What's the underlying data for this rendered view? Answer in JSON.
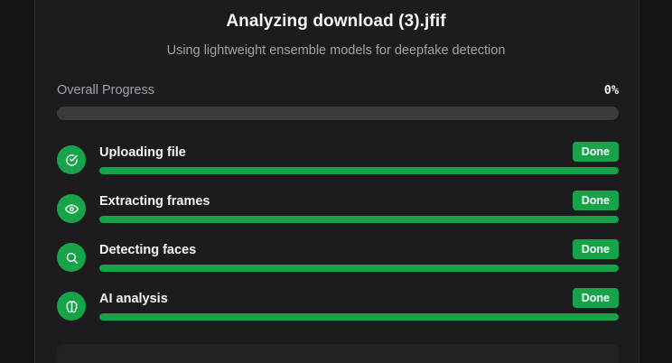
{
  "header": {
    "title": "Analyzing download (3).jfif",
    "subtitle": "Using lightweight ensemble models for deepfake detection"
  },
  "overall": {
    "label": "Overall Progress",
    "value_text": "0%",
    "progress": 0
  },
  "steps": [
    {
      "label": "Uploading file",
      "status": "Done",
      "progress": 100,
      "icon": "check-circle-icon"
    },
    {
      "label": "Extracting frames",
      "status": "Done",
      "progress": 100,
      "icon": "eye-icon"
    },
    {
      "label": "Detecting faces",
      "status": "Done",
      "progress": 100,
      "icon": "search-icon"
    },
    {
      "label": "AI analysis",
      "status": "Done",
      "progress": 100,
      "icon": "brain-icon"
    }
  ],
  "colors": {
    "accent": "#16a34a",
    "background": "#141416",
    "card": "#1c1c1f",
    "track": "#3a3a3f"
  }
}
